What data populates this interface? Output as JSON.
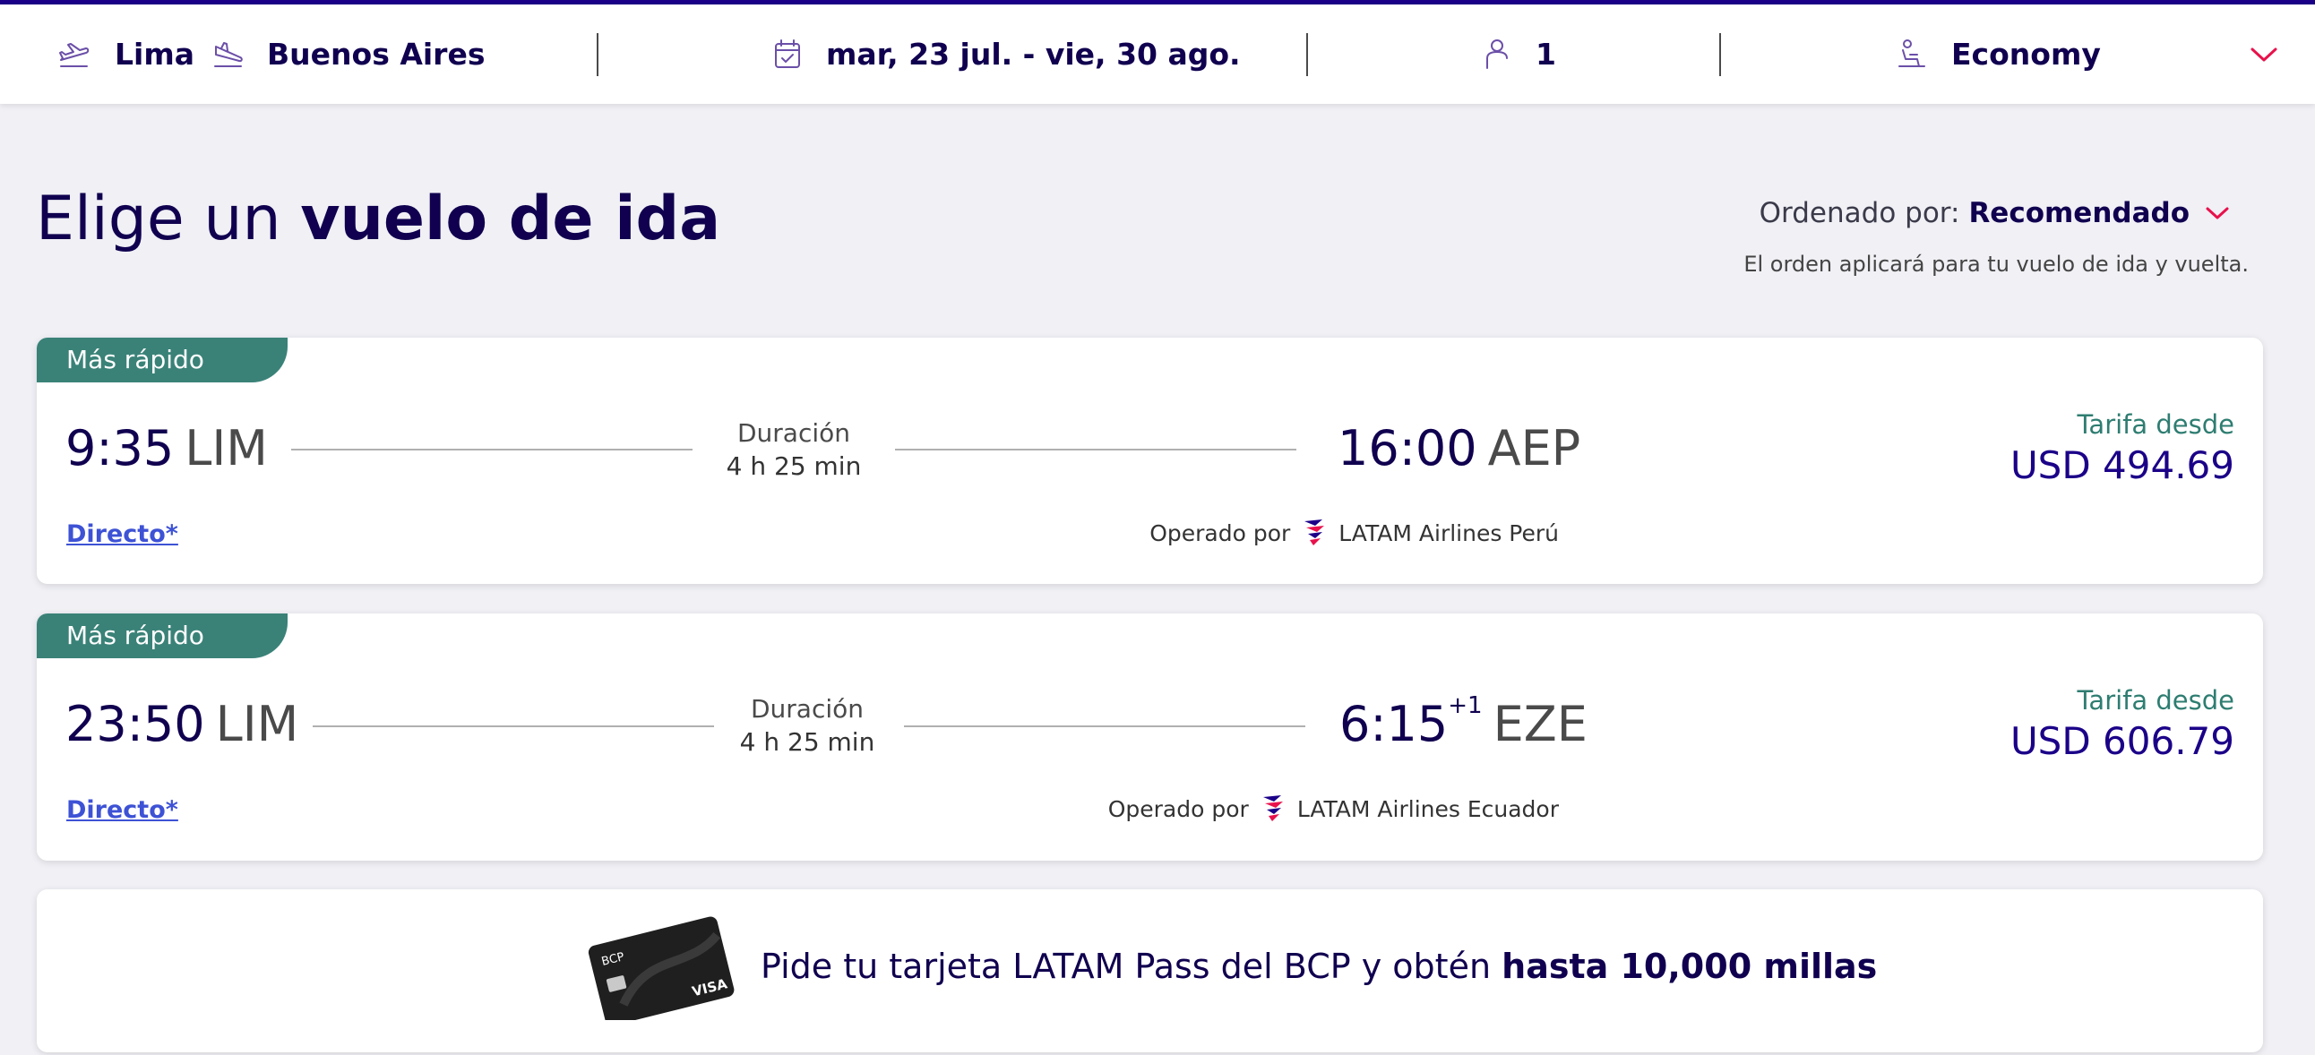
{
  "search": {
    "origin": "Lima",
    "destination": "Buenos Aires",
    "dates": "mar, 23 jul. - vie, 30 ago.",
    "passengers": "1",
    "cabin": "Economy"
  },
  "page": {
    "title_light": "Elige un",
    "title_bold": "vuelo de ida"
  },
  "sort": {
    "label": "Ordenado por:",
    "value": "Recomendado",
    "note": "El orden aplicará para tu vuelo de ida y vuelta."
  },
  "flights": [
    {
      "badge": "Más rápido",
      "dep_time": "9:35",
      "dep_code": "LIM",
      "duration_label": "Duración",
      "duration": "4 h 25 min",
      "arr_time": "16:00",
      "arr_day_offset": "",
      "arr_code": "AEP",
      "fare_label": "Tarifa desde",
      "price": "USD 494.69",
      "stops": "Directo*",
      "operated_label": "Operado por",
      "airline": "LATAM Airlines Perú"
    },
    {
      "badge": "Más rápido",
      "dep_time": "23:50",
      "dep_code": "LIM",
      "duration_label": "Duración",
      "duration": "4 h 25 min",
      "arr_time": "6:15",
      "arr_day_offset": "+1",
      "arr_code": "EZE",
      "fare_label": "Tarifa desde",
      "price": "USD 606.79",
      "stops": "Directo*",
      "operated_label": "Operado por",
      "airline": "LATAM Airlines Ecuador"
    }
  ],
  "promo": {
    "text": "Pide tu tarjeta LATAM Pass del BCP y obtén",
    "highlight": "hasta 10,000 millas",
    "card_brand": "BCP",
    "card_network": "VISA"
  },
  "colors": {
    "brand_dark": "#10004f",
    "brand_blue": "#1b0088",
    "accent_red": "#e8114b",
    "badge_green": "#3a8278",
    "icon_purple": "#6b4fa8",
    "link_blue": "#3d52d5"
  },
  "icons": {
    "origin": "plane-takeoff-icon",
    "destination": "plane-landing-icon",
    "dates": "calendar-icon",
    "passengers": "person-icon",
    "cabin": "seat-icon",
    "expand": "chevron-down-icon",
    "airline": "latam-logo-icon"
  }
}
